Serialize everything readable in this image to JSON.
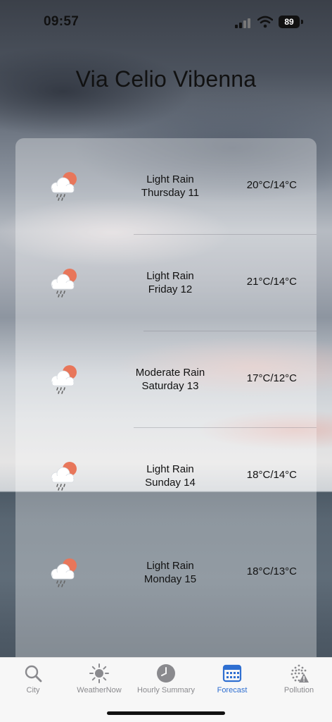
{
  "status_bar": {
    "time": "09:57",
    "battery": "89",
    "icons": [
      "cellular-signal-icon",
      "wifi-icon",
      "battery-icon"
    ]
  },
  "city_title": "Via Celio Vibenna",
  "forecast": [
    {
      "condition": "Light Rain",
      "day": "Thursday 11",
      "temps": "20°C/14°C",
      "icon": "sun-cloud-rain-icon"
    },
    {
      "condition": "Light Rain",
      "day": "Friday 12",
      "temps": "21°C/14°C",
      "icon": "sun-cloud-rain-icon"
    },
    {
      "condition": "Moderate Rain",
      "day": "Saturday 13",
      "temps": "17°C/12°C",
      "icon": "sun-cloud-rain-icon"
    },
    {
      "condition": "Light Rain",
      "day": "Sunday 14",
      "temps": "18°C/14°C",
      "icon": "sun-cloud-rain-icon"
    },
    {
      "condition": "Light Rain",
      "day": "Monday 15",
      "temps": "18°C/13°C",
      "icon": "sun-cloud-rain-icon"
    }
  ],
  "tab_bar": {
    "active_color": "#2f6fd1",
    "inactive_color": "#8a8a8e",
    "tabs": [
      {
        "label": "City",
        "icon": "search-icon",
        "active": false
      },
      {
        "label": "WeatherNow",
        "icon": "sun-icon",
        "active": false
      },
      {
        "label": "Hourly Summary",
        "icon": "clock-icon",
        "active": false
      },
      {
        "label": "Forecast",
        "icon": "calendar-icon",
        "active": true
      },
      {
        "label": "Pollution",
        "icon": "pollution-warning-icon",
        "active": false
      }
    ]
  }
}
